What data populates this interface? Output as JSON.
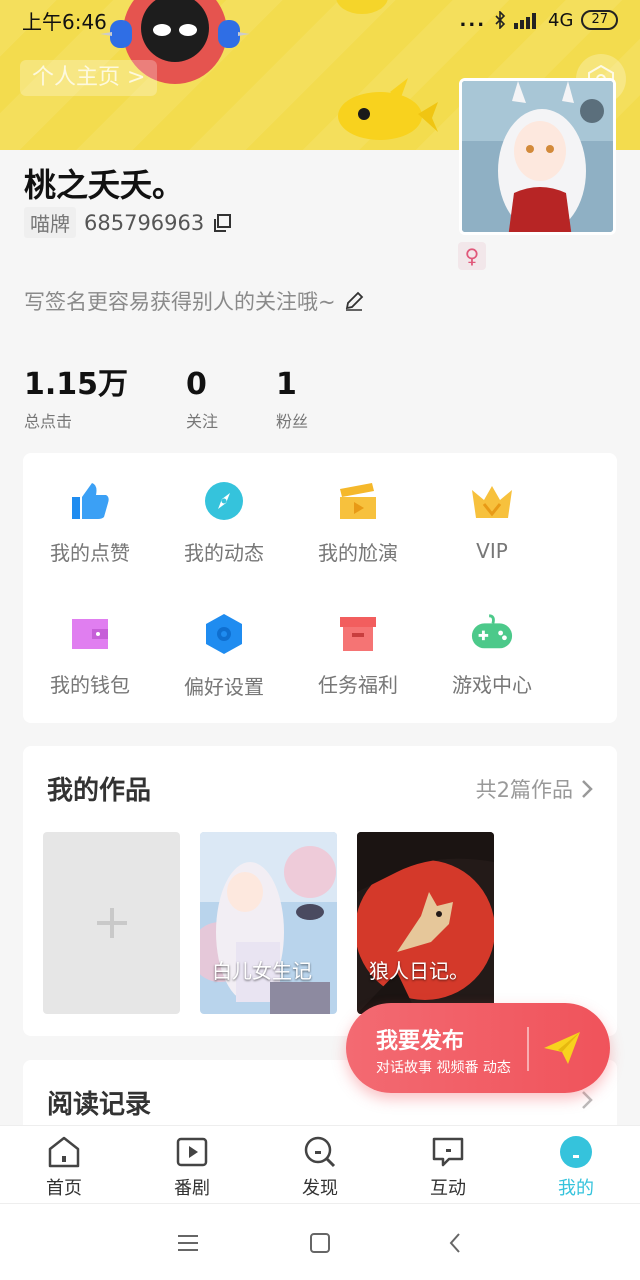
{
  "status_bar": {
    "time": "上午6:46",
    "dots": "...",
    "network": "4G",
    "battery": "27"
  },
  "header": {
    "home_link": "个人主页 >",
    "settings_icon": "hexagon-settings-icon"
  },
  "profile": {
    "nickname": "桃之夭夭。",
    "uid_tag": "喵牌",
    "uid": "685796963",
    "signature": "写签名更容易获得别人的关注哦~",
    "gender_symbol": "♀"
  },
  "stats": [
    {
      "value": "1.15万",
      "label": "总点击"
    },
    {
      "value": "0",
      "label": "关注"
    },
    {
      "value": "1",
      "label": "粉丝"
    }
  ],
  "menu": [
    {
      "label": "我的点赞",
      "icon": "thumbs-up-icon",
      "color": "#1f8cf0"
    },
    {
      "label": "我的动态",
      "icon": "compass-icon",
      "color": "#35c3dc"
    },
    {
      "label": "我的尬演",
      "icon": "clapperboard-icon",
      "color": "#f5b82b"
    },
    {
      "label": "VIP",
      "icon": "crown-icon",
      "color": "#f5b82b"
    },
    {
      "label": "我的钱包",
      "icon": "wallet-icon",
      "color": "#e07ef0"
    },
    {
      "label": "偏好设置",
      "icon": "hexagon-gear-icon",
      "color": "#1f8cf0"
    },
    {
      "label": "任务福利",
      "icon": "gift-box-icon",
      "color": "#f25e5e"
    },
    {
      "label": "游戏中心",
      "icon": "gamepad-icon",
      "color": "#4cc98a"
    }
  ],
  "works": {
    "title": "我的作品",
    "count": "共2篇作品",
    "items": [
      {
        "title": "白儿女生记"
      },
      {
        "title": "狼人日记。"
      }
    ]
  },
  "reading": {
    "title": "阅读记录"
  },
  "publish": {
    "title": "我要发布",
    "subtitle": "对话故事 视频番 动态"
  },
  "tabs": [
    {
      "label": "首页",
      "icon": "home-icon"
    },
    {
      "label": "番剧",
      "icon": "play-icon"
    },
    {
      "label": "发现",
      "icon": "discover-icon"
    },
    {
      "label": "互动",
      "icon": "message-icon"
    },
    {
      "label": "我的",
      "icon": "me-icon",
      "active": true
    }
  ],
  "colors": {
    "accent": "#35c3dc",
    "banner": "#f3dc4e",
    "publish": "#f0535b"
  }
}
